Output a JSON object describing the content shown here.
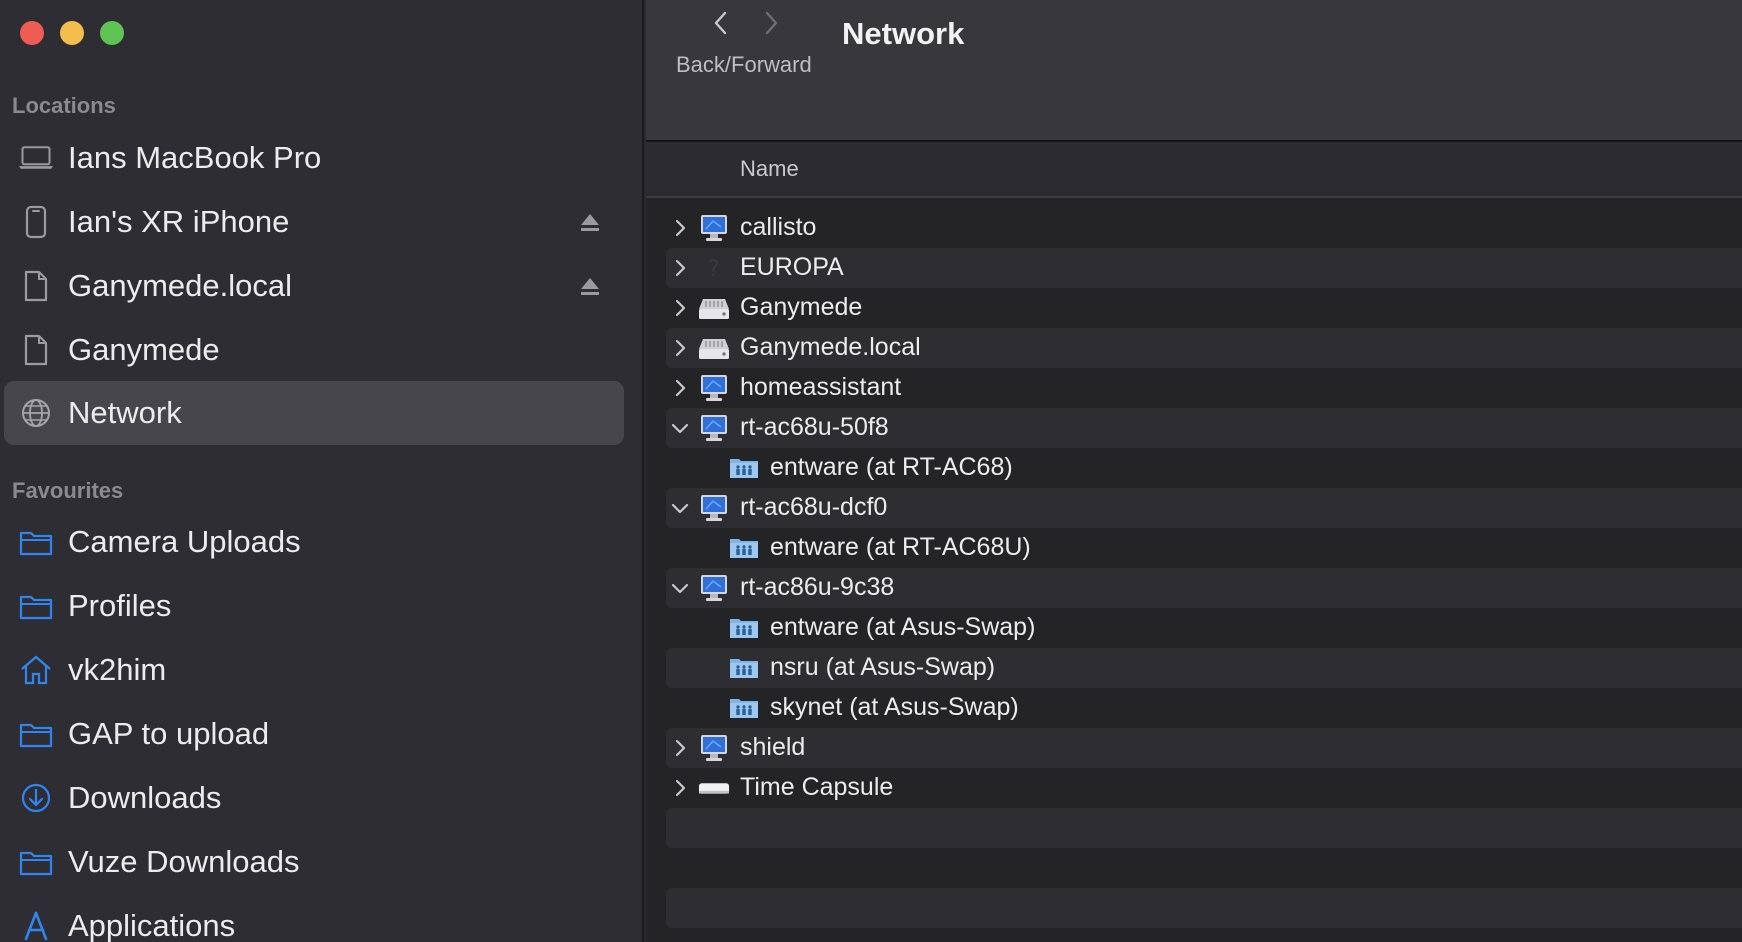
{
  "sidebar": {
    "locations_title": "Locations",
    "favourites_title": "Favourites",
    "locations": [
      {
        "label": "Ians MacBook Pro",
        "icon": "laptop-icon",
        "eject": false
      },
      {
        "label": "Ian's XR iPhone",
        "icon": "iphone-icon",
        "eject": true
      },
      {
        "label": "Ganymede.local",
        "icon": "document-icon",
        "eject": true
      },
      {
        "label": "Ganymede",
        "icon": "document-icon",
        "eject": false
      },
      {
        "label": "Network",
        "icon": "globe-icon",
        "eject": false,
        "selected": true
      }
    ],
    "favourites": [
      {
        "label": "Camera Uploads",
        "icon": "folder-icon"
      },
      {
        "label": "Profiles",
        "icon": "folder-icon"
      },
      {
        "label": "vk2him",
        "icon": "home-icon"
      },
      {
        "label": "GAP to upload",
        "icon": "folder-icon"
      },
      {
        "label": "Downloads",
        "icon": "download-icon"
      },
      {
        "label": "Vuze Downloads",
        "icon": "folder-icon"
      },
      {
        "label": "Applications",
        "icon": "applications-icon"
      }
    ]
  },
  "toolbar": {
    "title": "Network",
    "nav_caption": "Back/Forward"
  },
  "list": {
    "column_name": "Name",
    "rows": [
      {
        "label": "callisto",
        "icon": "computer-icon",
        "expanded": false,
        "level": 0
      },
      {
        "label": "EUROPA",
        "icon": "unknown-icon",
        "expanded": false,
        "level": 0
      },
      {
        "label": "Ganymede",
        "icon": "server-icon",
        "expanded": false,
        "level": 0
      },
      {
        "label": "Ganymede.local",
        "icon": "server-icon",
        "expanded": false,
        "level": 0
      },
      {
        "label": "homeassistant",
        "icon": "computer-icon",
        "expanded": false,
        "level": 0
      },
      {
        "label": "rt-ac68u-50f8",
        "icon": "computer-icon",
        "expanded": true,
        "level": 0
      },
      {
        "label": "entware (at RT-AC68)",
        "icon": "shared-folder-icon",
        "level": 1
      },
      {
        "label": "rt-ac68u-dcf0",
        "icon": "computer-icon",
        "expanded": true,
        "level": 0
      },
      {
        "label": "entware (at RT-AC68U)",
        "icon": "shared-folder-icon",
        "level": 1
      },
      {
        "label": "rt-ac86u-9c38",
        "icon": "computer-icon",
        "expanded": true,
        "level": 0
      },
      {
        "label": "entware (at Asus-Swap)",
        "icon": "shared-folder-icon",
        "level": 1
      },
      {
        "label": "nsru (at Asus-Swap)",
        "icon": "shared-folder-icon",
        "level": 1
      },
      {
        "label": "skynet (at Asus-Swap)",
        "icon": "shared-folder-icon",
        "level": 1
      },
      {
        "label": "shield",
        "icon": "computer-icon",
        "expanded": false,
        "level": 0
      },
      {
        "label": "Time Capsule",
        "icon": "time-capsule-icon",
        "expanded": false,
        "level": 0
      }
    ]
  },
  "colors": {
    "accent": "#2f86ef",
    "close": "#ee5c54",
    "minimize": "#f4be4f",
    "maximize": "#5fc454"
  }
}
